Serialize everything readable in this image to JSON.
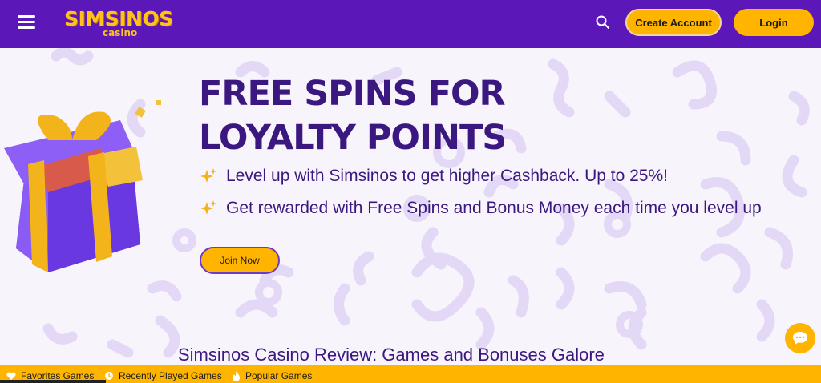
{
  "header": {
    "logo_main": "SIMSINOS",
    "logo_sub": "casino",
    "create_account_label": "Create Account",
    "login_label": "Login"
  },
  "hero": {
    "title_line1": "FREE SPINS FOR",
    "title_line2": "LOYALTY POINTS",
    "bullets": [
      "Level up with Simsinos to get higher Cashback. Up to 25%!",
      "Get rewarded with Free Spins and Bonus Money each time you level up"
    ],
    "join_label": "Join Now"
  },
  "review": {
    "title": "Simsinos Casino Review: Games and Bonuses Galore"
  },
  "bottom_bar": {
    "items": [
      "Favorites Games",
      "Recently Played Games",
      "Popular Games"
    ]
  },
  "colors": {
    "header_bg": "#5b17b8",
    "accent": "#ffb400",
    "text_dark_purple": "#3b1880",
    "page_bg": "#f7f4fb"
  },
  "icons": [
    "hamburger-menu-icon",
    "search-icon",
    "sparkle-icon",
    "chat-icon",
    "heart-icon",
    "clock-icon",
    "fire-icon",
    "gift-box-icon"
  ]
}
